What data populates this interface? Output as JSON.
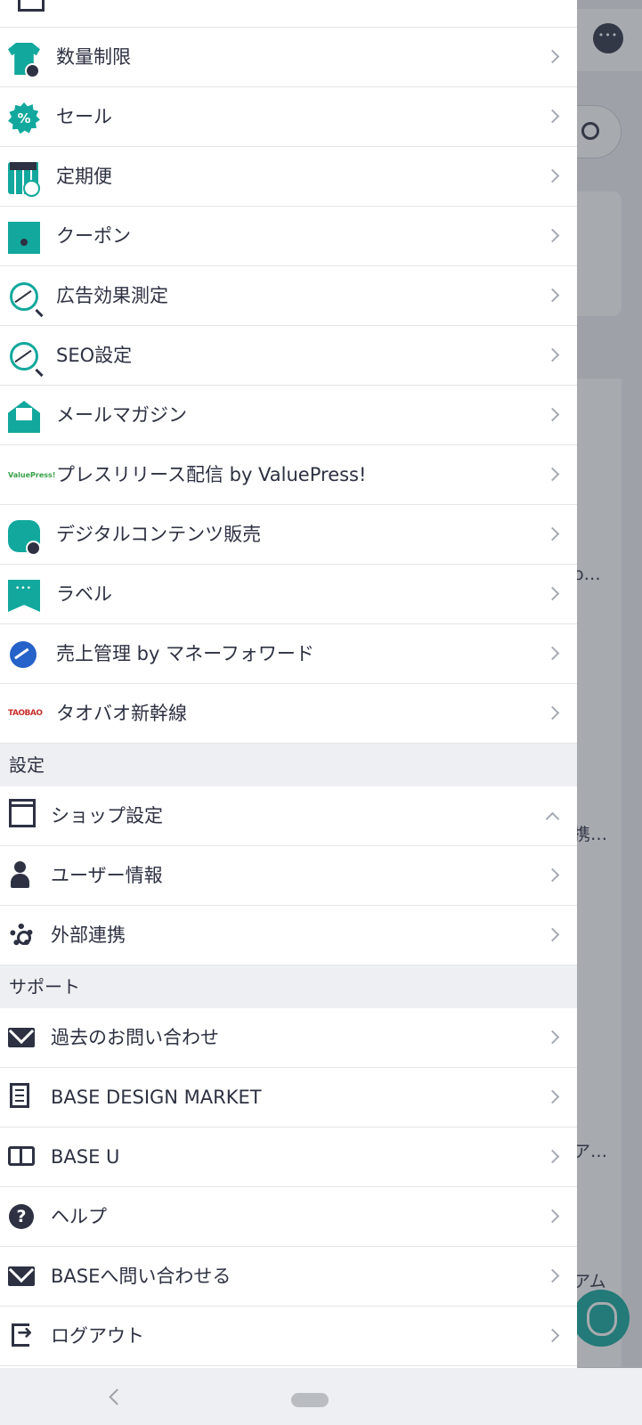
{
  "background": {
    "text_fragments": [
      "o…",
      "携…",
      "ア…",
      "アム"
    ]
  },
  "menu": {
    "top_items": [
      {
        "label": "数量制限",
        "icon": "tshirt-icon"
      },
      {
        "label": "セール",
        "icon": "sale-badge-icon"
      },
      {
        "label": "定期便",
        "icon": "subscription-calendar-icon"
      },
      {
        "label": "クーポン",
        "icon": "coupon-icon"
      },
      {
        "label": "広告効果測定",
        "icon": "ad-analytics-icon"
      },
      {
        "label": "SEO設定",
        "icon": "seo-chart-icon"
      },
      {
        "label": "メールマガジン",
        "icon": "mail-magazine-icon"
      },
      {
        "label": "プレスリリース配信 by ValuePress!",
        "icon": "valuepress-logo"
      },
      {
        "label": "デジタルコンテンツ販売",
        "icon": "digital-content-cloud-icon"
      },
      {
        "label": "ラベル",
        "icon": "label-flag-icon"
      },
      {
        "label": "売上管理 by マネーフォワード",
        "icon": "moneyforward-logo"
      },
      {
        "label": "タオバオ新幹線",
        "icon": "taobao-logo"
      }
    ],
    "settings_header": "設定",
    "settings_items": [
      {
        "label": "ショップ設定",
        "icon": "store-icon"
      },
      {
        "label": "ユーザー情報",
        "icon": "user-icon"
      },
      {
        "label": "外部連携",
        "icon": "gear-icon"
      }
    ],
    "support_header": "サポート",
    "support_items": [
      {
        "label": "過去のお問い合わせ",
        "icon": "envelope-icon"
      },
      {
        "label": "BASE DESIGN MARKET",
        "icon": "document-icon"
      },
      {
        "label": "BASE U",
        "icon": "book-icon"
      },
      {
        "label": "ヘルプ",
        "icon": "help-icon"
      },
      {
        "label": "BASEへ問い合わせる",
        "icon": "envelope-icon"
      },
      {
        "label": "ログアウト",
        "icon": "logout-icon"
      }
    ]
  },
  "icon_glyphs": {
    "sale": "%",
    "valuepress": "ValuePress!",
    "taobao": "TAOBAO",
    "help": "?"
  },
  "colors": {
    "accent_teal": "#12a89d",
    "icon_dark": "#2d3142",
    "text": "#2d3142"
  }
}
